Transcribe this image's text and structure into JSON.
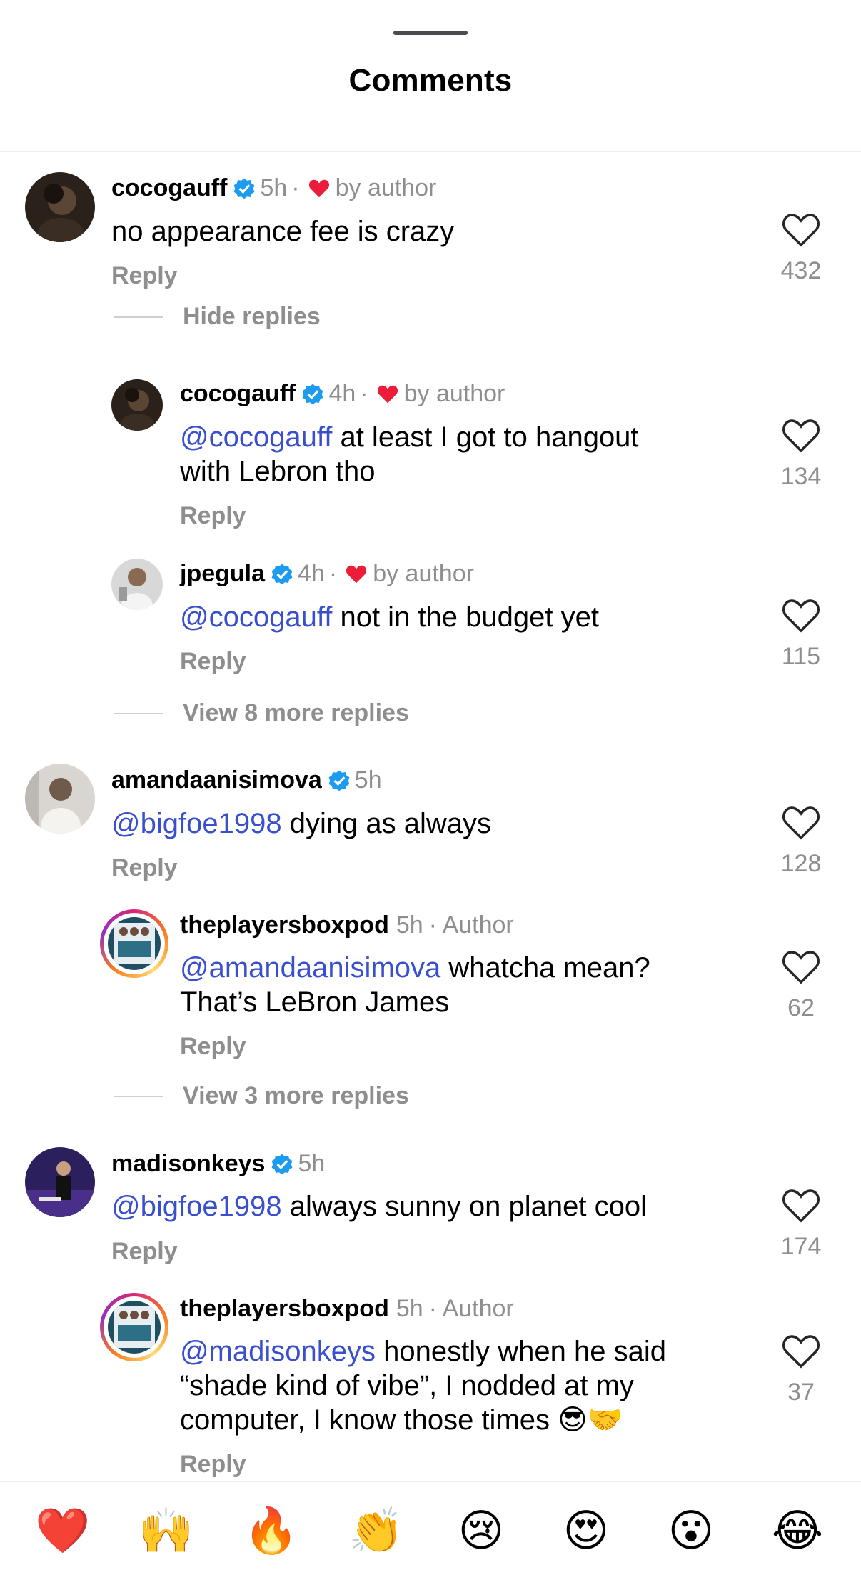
{
  "header": {
    "title": "Comments"
  },
  "comments": [
    {
      "username": "cocogauff",
      "verified": true,
      "time": "5h",
      "liked_by_author": true,
      "author_badge": "by author",
      "mention": "",
      "text": "no appearance fee is crazy",
      "reply_label": "Reply",
      "likes": "432",
      "thread_toggle": "Hide replies",
      "replies": [
        {
          "username": "cocogauff",
          "verified": true,
          "time": "4h",
          "author_badge": "by author",
          "mention": "@cocogauff",
          "text_line1": " at least I got to hangout",
          "text_line2": "with Lebron tho",
          "reply_label": "Reply",
          "likes": "134"
        },
        {
          "username": "jpegula",
          "verified": true,
          "time": "4h",
          "author_badge": "by author",
          "mention": "@cocogauff",
          "text": " not in the budget yet",
          "reply_label": "Reply",
          "likes": "115"
        }
      ],
      "more_replies": "View 8 more replies"
    },
    {
      "username": "amandaanisimova",
      "verified": true,
      "time": "5h",
      "mention": "@bigfoe1998",
      "text": " dying as always",
      "reply_label": "Reply",
      "likes": "128",
      "replies": [
        {
          "username": "theplayersboxpod",
          "time": "5h",
          "author_tag": "· Author",
          "mention": "@amandaanisimova",
          "text_line1": " whatcha mean?",
          "text_line2": "That’s LeBron James",
          "reply_label": "Reply",
          "likes": "62"
        }
      ],
      "more_replies": "View 3 more replies"
    },
    {
      "username": "madisonkeys",
      "verified": true,
      "time": "5h",
      "mention": "@bigfoe1998",
      "text": " always sunny on planet cool",
      "reply_label": "Reply",
      "likes": "174",
      "replies": [
        {
          "username": "theplayersboxpod",
          "time": "5h",
          "author_tag": "· Author",
          "mention": "@madisonkeys",
          "text_line1": " honestly when he said",
          "text_line2": "“shade kind of vibe”, I nodded at my",
          "text_line3": "computer, I know those times 😎🤝",
          "reply_label": "Reply",
          "likes": "37"
        }
      ]
    }
  ],
  "emoji_bar": [
    "❤️",
    "🙌",
    "🔥",
    "👏",
    "😢",
    "😍",
    "😮",
    "😂"
  ],
  "colors": {
    "mention": "#3a4fce",
    "verified": "#1d9bf0",
    "heart": "#ed1c3a",
    "muted": "#8e8e8e"
  }
}
